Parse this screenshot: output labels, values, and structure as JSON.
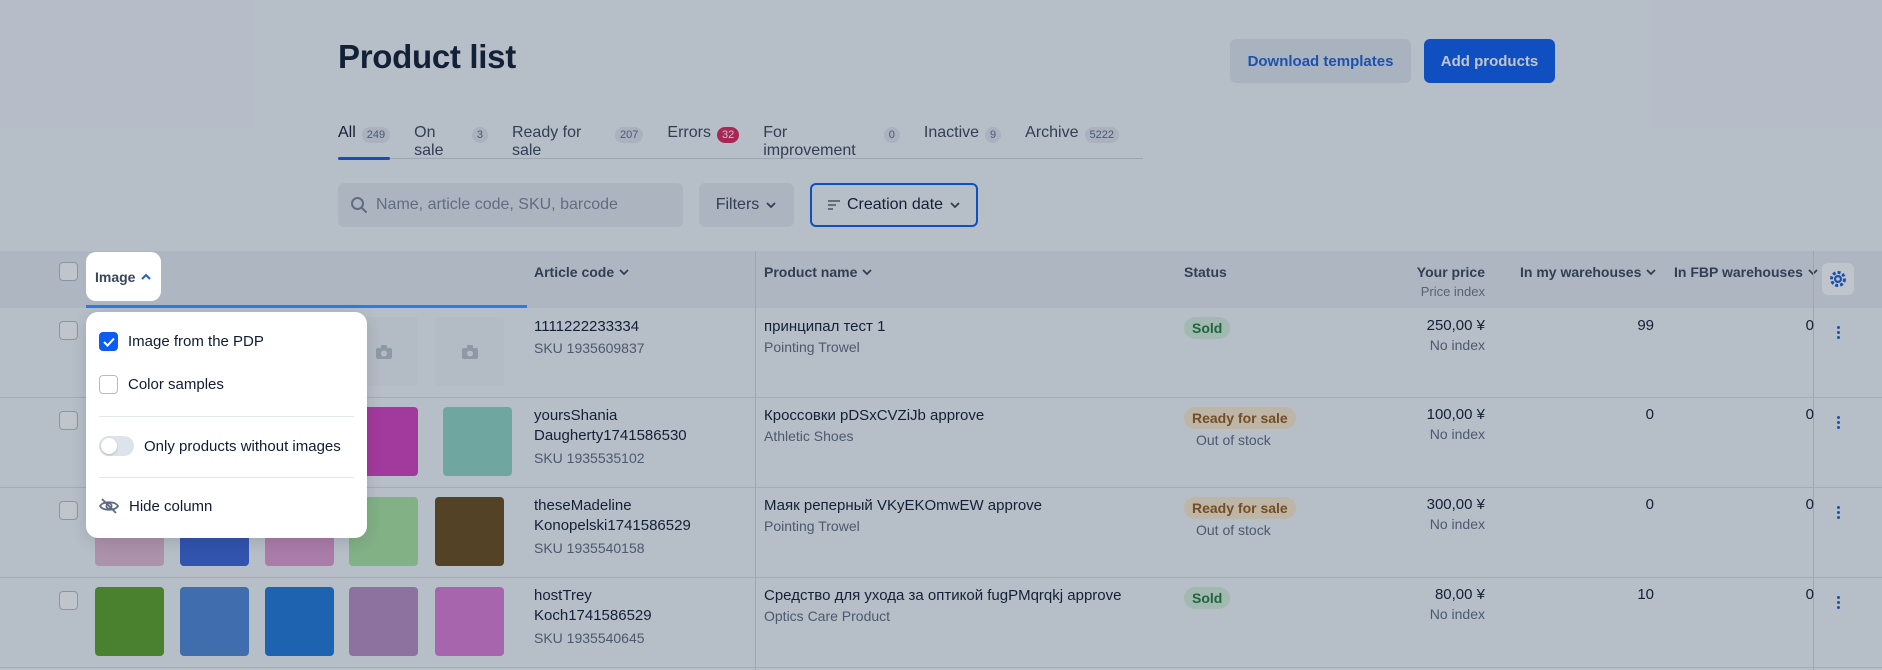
{
  "header": {
    "title": "Product list",
    "download_label": "Download templates",
    "add_label": "Add products"
  },
  "tabs": [
    {
      "label": "All",
      "count": "249",
      "active": true
    },
    {
      "label": "On sale",
      "count": "3"
    },
    {
      "label": "Ready for sale",
      "count": "207"
    },
    {
      "label": "Errors",
      "count": "32"
    },
    {
      "label": "For improvement",
      "count": "0"
    },
    {
      "label": "Inactive",
      "count": "9"
    },
    {
      "label": "Archive",
      "count": "5222"
    }
  ],
  "search": {
    "placeholder": "Name, article code, SKU, barcode"
  },
  "filters_label": "Filters",
  "sort_label": "Creation date",
  "columns": {
    "image": "Image",
    "article": "Article code",
    "name": "Product name",
    "status": "Status",
    "price": "Your price",
    "price_sub": "Price index",
    "my_wh": "In my warehouses",
    "fbp_wh": "In FBP warehouses"
  },
  "rows": [
    {
      "article": "1111222233334",
      "sku": "SKU 1935609837",
      "name": "принципал тест 1",
      "category": "Pointing Trowel",
      "status": "Sold",
      "stock_note": "",
      "price": "250,00 ¥",
      "index": "No index",
      "my": "99",
      "fbp": "0"
    },
    {
      "article_l1": "yoursShania",
      "article_l2": "Daugherty1741586530",
      "sku": "SKU 1935535102",
      "name": "Кроссовки pDSxCVZiJb approve",
      "category": "Athletic Shoes",
      "status": "Ready for sale",
      "stock_note": "Out of stock",
      "price": "100,00 ¥",
      "index": "No index",
      "my": "0",
      "fbp": "0"
    },
    {
      "article_l1": "theseMadeline",
      "article_l2": "Konopelski1741586529",
      "sku": "SKU 1935540158",
      "name": "Маяк реперный VKyEKOmwEW approve",
      "category": "Pointing Trowel",
      "status": "Ready for sale",
      "stock_note": "Out of stock",
      "price": "300,00 ¥",
      "index": "No index",
      "my": "0",
      "fbp": "0"
    },
    {
      "article_l1": "hostTrey",
      "article_l2": "Koch1741586529",
      "sku": "SKU 1935540645",
      "name": "Средство для ухода за оптикой fugPMqrqkj approve",
      "category": "Optics Care Product",
      "status": "Sold",
      "stock_note": "",
      "price": "80,00 ¥",
      "index": "No index",
      "my": "10",
      "fbp": "0"
    }
  ],
  "popup": {
    "opt_pdp": "Image from the PDP",
    "opt_colors": "Color samples",
    "opt_only": "Only products without images",
    "opt_hide": "Hide column"
  },
  "colors": {
    "accent": "#0b5cf0",
    "thumbs_row2": [
      "#d63fbf",
      "#8fd6c4"
    ],
    "thumbs_row3": [
      "#e3b9d2",
      "#3b63d9",
      "#e29ad0",
      "#a9e3a0",
      "#6a4a1c"
    ],
    "thumbs_row4": [
      "#5aa127",
      "#4e86d7",
      "#1f78d9",
      "#b98bc3",
      "#dd7ad6"
    ]
  }
}
